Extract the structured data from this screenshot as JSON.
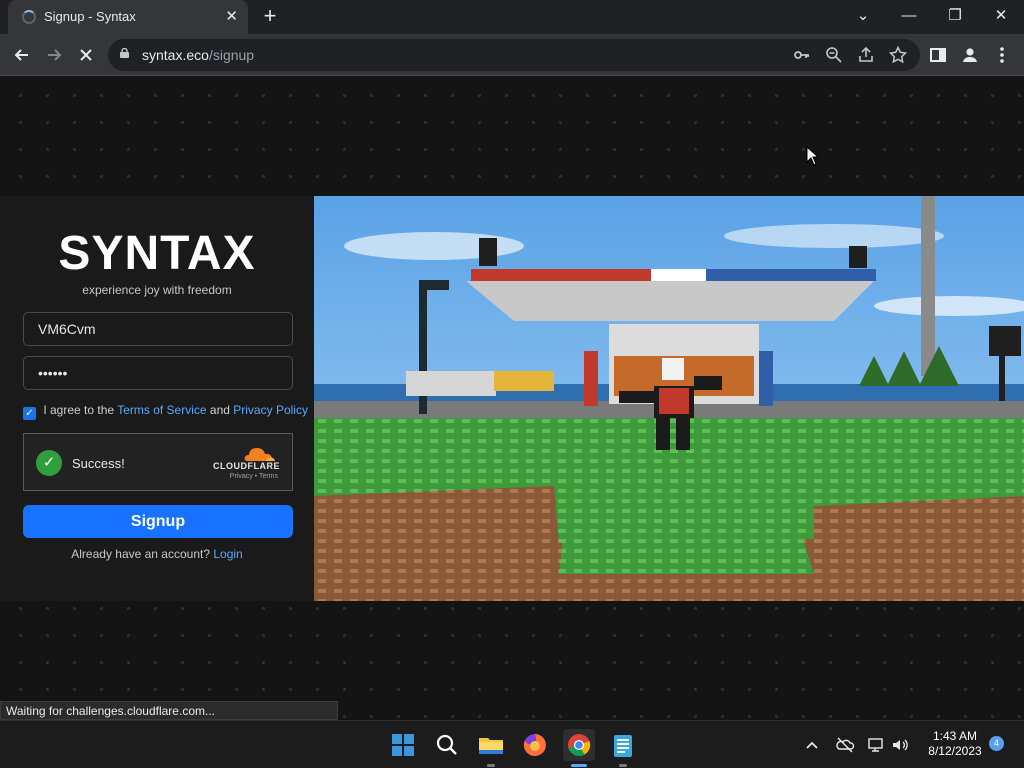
{
  "browser": {
    "tab_title": "Signup - Syntax",
    "tab_close": "✕",
    "new_tab": "+",
    "window_controls": {
      "tabsearch": "⌄",
      "minimize": "—",
      "restore": "❐",
      "close": "✕"
    },
    "url_host": "syntax.eco",
    "url_path": "/signup"
  },
  "signup": {
    "logo": "SYNTAX",
    "tagline": "experience joy with freedom",
    "username_value": "VM6Cvm",
    "password_value": "••••••",
    "agree_prefix": "I agree to the",
    "terms_link": "Terms of Service",
    "agree_and": "and",
    "privacy_link": "Privacy Policy",
    "agree_checked": true,
    "captcha": {
      "status": "Success!",
      "provider": "CLOUDFLARE",
      "links": "Privacy • Terms"
    },
    "signup_button": "Signup",
    "already_text": "Already have an account?",
    "login_link": "Login"
  },
  "status_bar": "Waiting for challenges.cloudflare.com...",
  "taskbar": {
    "time": "1:43 AM",
    "date": "8/12/2023",
    "notification_count": "4"
  },
  "colors": {
    "accent": "#1672ff",
    "link": "#5aa7ff",
    "success": "#2e9e3e",
    "cloudflare_orange": "#f48120"
  }
}
